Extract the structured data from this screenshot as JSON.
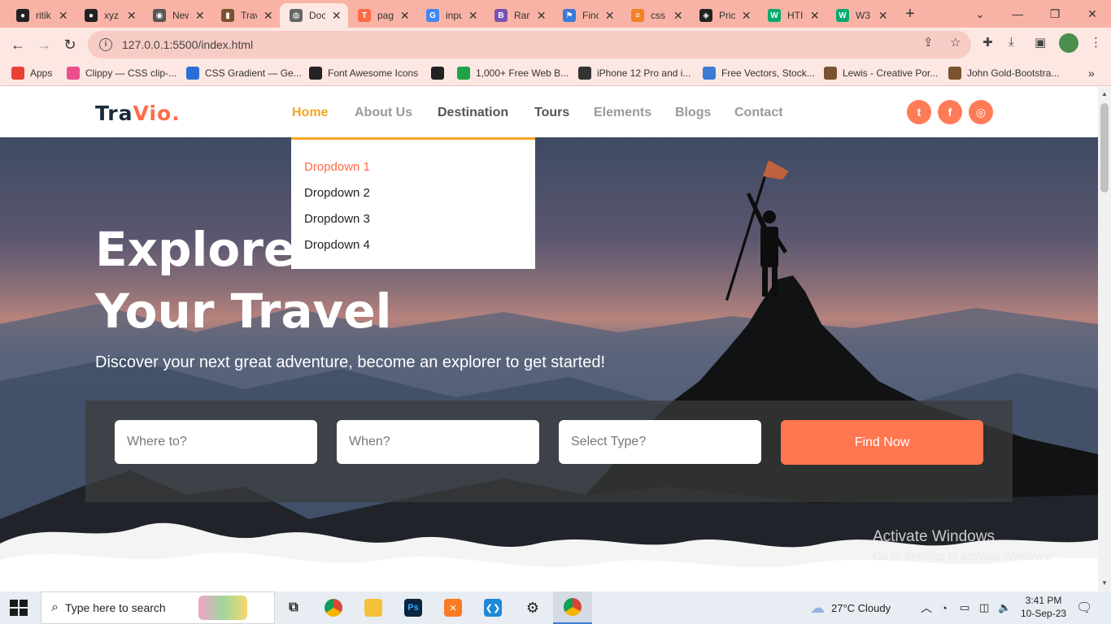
{
  "browser": {
    "tabs": [
      {
        "title": "ritik",
        "icon": "github-icon",
        "color": "#222222",
        "glyph": "●"
      },
      {
        "title": "xyz",
        "icon": "github-icon",
        "color": "#222222",
        "glyph": "●"
      },
      {
        "title": "New",
        "icon": "chrome-icon",
        "color": "#555555",
        "glyph": "◉"
      },
      {
        "title": "Trav",
        "icon": "travel-icon",
        "color": "#7a5230",
        "glyph": "▮"
      },
      {
        "title": "Doc",
        "icon": "globe-icon",
        "color": "#666666",
        "glyph": "◍"
      },
      {
        "title": "pag",
        "icon": "t-icon",
        "color": "#ff6b47",
        "glyph": "T"
      },
      {
        "title": "inpu",
        "icon": "google-icon",
        "color": "#4285f4",
        "glyph": "G"
      },
      {
        "title": "Ran",
        "icon": "bootstrap-icon",
        "color": "#7952b3",
        "glyph": "B"
      },
      {
        "title": "Finc",
        "icon": "flag-icon",
        "color": "#3b7bd6",
        "glyph": "⚑"
      },
      {
        "title": "css",
        "icon": "stackoverflow-icon",
        "color": "#f48024",
        "glyph": "≡"
      },
      {
        "title": "Pric",
        "icon": "codepen-icon",
        "color": "#222222",
        "glyph": "◈"
      },
      {
        "title": "HTI",
        "icon": "w3-icon",
        "color": "#04aa6d",
        "glyph": "W"
      },
      {
        "title": "W3",
        "icon": "w3-icon",
        "color": "#04aa6d",
        "glyph": "W"
      }
    ],
    "url": "127.0.0.1:5500/index.html",
    "bookmarks": [
      {
        "label": "Apps",
        "icon": "apps-grid-icon",
        "color": "#e94235"
      },
      {
        "label": "Clippy — CSS clip-...",
        "icon": "clippy-icon",
        "color": "#e94f8a"
      },
      {
        "label": "CSS Gradient — Ge...",
        "icon": "gradient-icon",
        "color": "#2a6fd6"
      },
      {
        "label": "Font Awesome Icons",
        "icon": "fontawesome-icon",
        "color": "#222222"
      },
      {
        "label": "",
        "icon": "globe-icon",
        "color": "#222222"
      },
      {
        "label": "1,000+ Free Web B...",
        "icon": "px-icon",
        "color": "#1fa34a"
      },
      {
        "label": "iPhone 12 Pro and i...",
        "icon": "apple-icon",
        "color": "#333333"
      },
      {
        "label": "Free Vectors, Stock...",
        "icon": "freepik-icon",
        "color": "#3b7bd6"
      },
      {
        "label": "Lewis - Creative Por...",
        "icon": "portfolio-icon",
        "color": "#7a5230"
      },
      {
        "label": "John Gold-Bootstra...",
        "icon": "portfolio-icon",
        "color": "#7a5230"
      }
    ]
  },
  "site": {
    "logo_main": "Tra",
    "logo_accent": "Vio.",
    "nav": [
      "Home",
      "About Us",
      "Destination",
      "Tours",
      "Elements",
      "Blogs",
      "Contact"
    ],
    "dropdown": [
      "Dropdown 1",
      "Dropdown 2",
      "Dropdown 3",
      "Dropdown 4"
    ],
    "social": [
      {
        "name": "twitter-icon",
        "glyph": "t"
      },
      {
        "name": "facebook-icon",
        "glyph": "f"
      },
      {
        "name": "instagram-icon",
        "glyph": "◎"
      }
    ],
    "hero_line1": "Explore",
    "hero_line2": "Your Travel",
    "hero_sub": "Discover your next great adventure, become an explorer to get started!",
    "search": {
      "where_placeholder": "Where to?",
      "when_placeholder": "When?",
      "type_placeholder": "Select Type?",
      "button": "Find Now"
    },
    "accent_color": "#ff6b47",
    "active_color": "#f5a623"
  },
  "watermark": {
    "line1": "Activate Windows",
    "line2": "Go to Settings to activate Windows."
  },
  "taskbar": {
    "search_placeholder": "Type here to search",
    "weather": "27°C  Cloudy",
    "time": "3:41 PM",
    "date": "10-Sep-23"
  }
}
